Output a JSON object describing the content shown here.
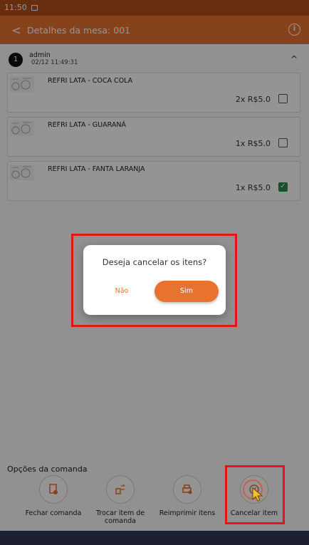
{
  "status_bar": {
    "time": "11:50"
  },
  "app_bar": {
    "back_glyph": "<",
    "title": "Detalhes da mesa: 001",
    "info_glyph": "i"
  },
  "order": {
    "number": "1",
    "user": "admin",
    "datetime": "02/12 11:49:31",
    "collapse_glyph": "^"
  },
  "items": [
    {
      "name": "REFRI LATA - COCA COLA",
      "price": "2x R$5.0",
      "checked": false
    },
    {
      "name": "REFRI LATA - GUARANÁ",
      "price": "1x R$5.0",
      "checked": false
    },
    {
      "name": "REFRI LATA - FANTA LARANJA",
      "price": "1x R$5.0",
      "checked": true
    }
  ],
  "options": {
    "title": "Opções da comanda",
    "buttons": [
      {
        "label": "Fechar comanda",
        "icon": "receipt-icon"
      },
      {
        "label": "Trocar item de comanda",
        "icon": "swap-icon"
      },
      {
        "label": "Reimprimir itens",
        "icon": "printer-icon"
      },
      {
        "label": "Cancelar item",
        "icon": "cancel-icon"
      }
    ]
  },
  "dialog": {
    "message": "Deseja cancelar os itens?",
    "no_label": "Não",
    "yes_label": "Sim"
  },
  "colors": {
    "accent": "#e7732f",
    "status_bar": "#b24f19",
    "highlight": "#e0161b",
    "check": "#2a8a4a"
  }
}
